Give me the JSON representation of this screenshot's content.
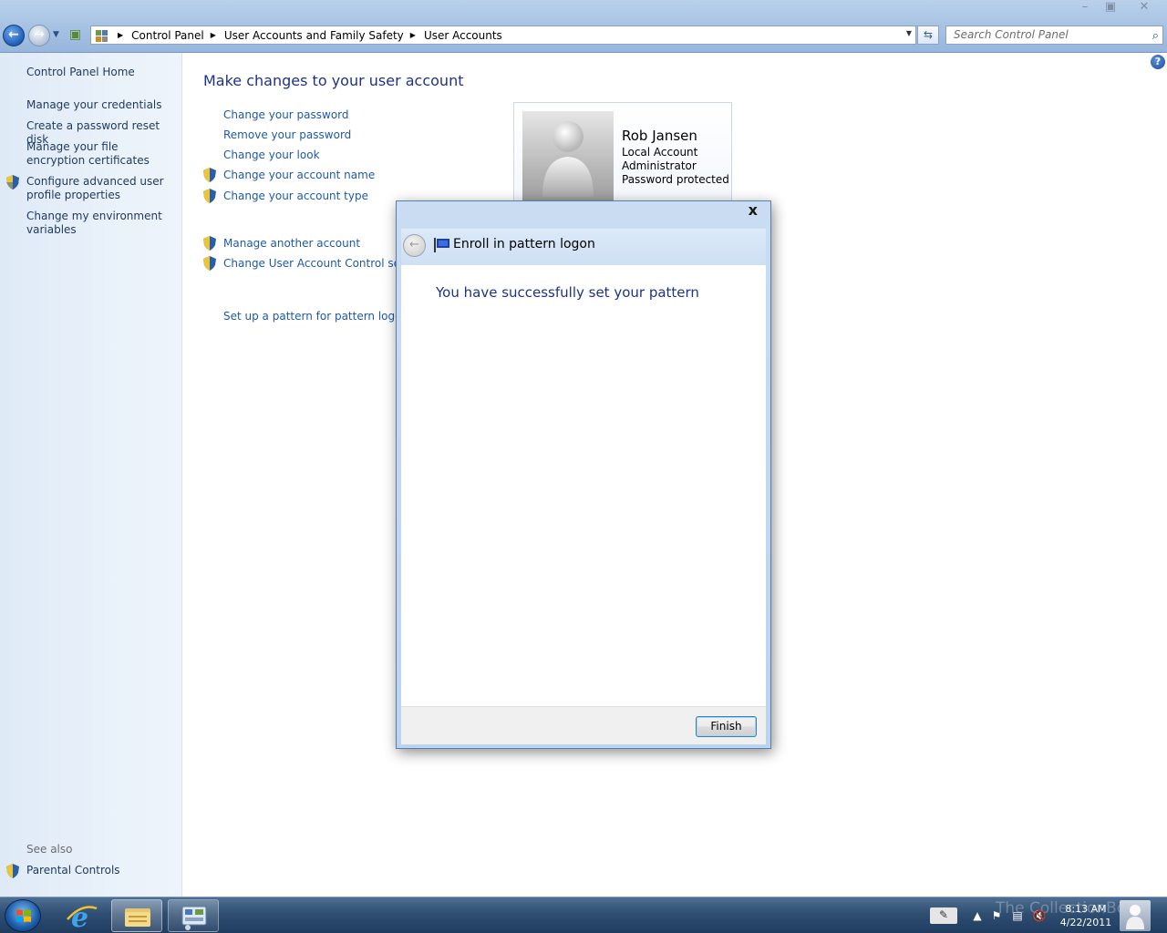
{
  "window": {
    "minimize": "–",
    "maximize": "▣",
    "close": "✕"
  },
  "address": {
    "crumbs": [
      "Control Panel",
      "User Accounts and Family Safety",
      "User Accounts"
    ]
  },
  "search": {
    "placeholder": "Search Control Panel"
  },
  "left_nav": {
    "home": "Control Panel Home",
    "items": [
      "Manage your credentials",
      "Create a password reset disk",
      "Manage your file encryption certificates",
      "Configure advanced user profile properties",
      "Change my environment variables"
    ],
    "see_also_label": "See also",
    "see_also_items": [
      "Parental Controls"
    ]
  },
  "main": {
    "title": "Make changes to your user account",
    "tasks": [
      "Change your password",
      "Remove your password",
      "Change your look",
      "Change your account name",
      "Change your account type"
    ],
    "other_tasks": [
      "Manage another account",
      "Change User Account Control settin"
    ],
    "pattern_link": "Set up a pattern for pattern logon"
  },
  "user": {
    "name": "Rob Jansen",
    "details": [
      "Local Account",
      "Administrator",
      "Password protected"
    ]
  },
  "dialog": {
    "close": "x",
    "title": "Enroll in pattern logon",
    "message": "You have successfully set your pattern",
    "finish_label": "Finish"
  },
  "taskbar": {
    "time": "8:13 AM",
    "date": "4/22/2011",
    "watermark": "The CollectionBook"
  },
  "colors": {
    "link": "#1e5aa8",
    "heading": "#1e3287",
    "taskbar": "#2f4e72"
  }
}
